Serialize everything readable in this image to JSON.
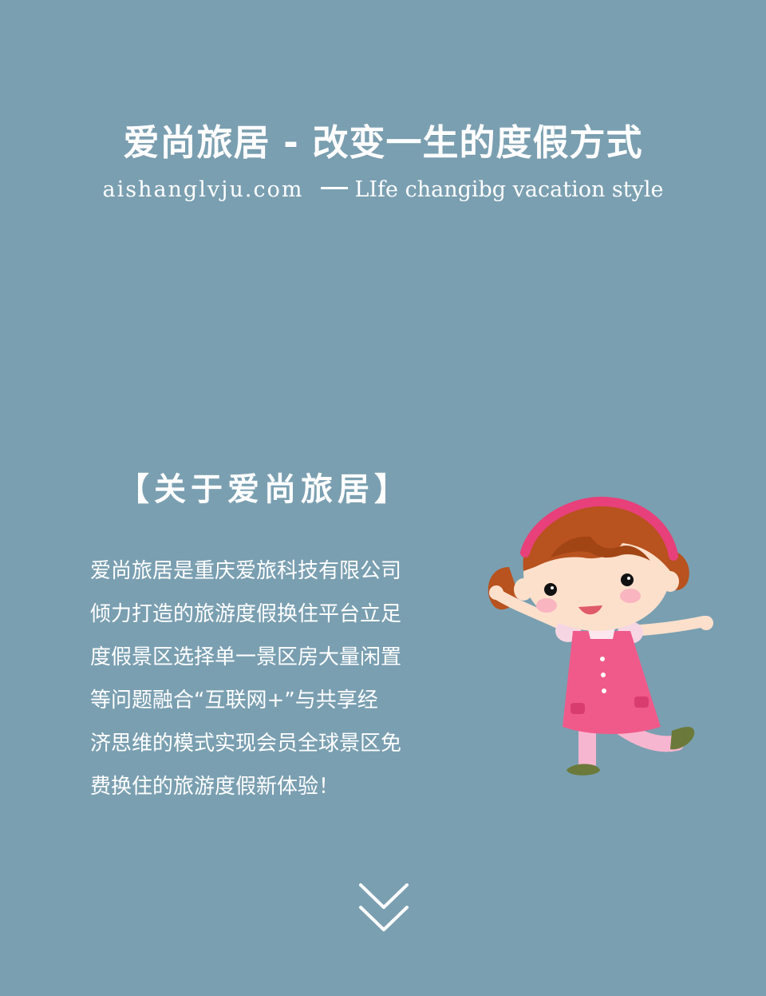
{
  "hero": {
    "title": "爱尚旅居 - 改变一生的度假方式",
    "domain": "aishanglvju.com",
    "tagline": "LIfe changibg vacation style"
  },
  "about": {
    "title": "【关于爱尚旅居】",
    "lines": [
      "爱尚旅居是重庆爱旅科技有限公司",
      "倾力打造的旅游度假换住平台立足",
      "度假景区选择单一景区房大量闲置",
      "等问题融合“互联网+”与共享经",
      "济思维的模式实现会员全球景区免",
      "费换住的旅游度假新体验！"
    ]
  },
  "icons": {
    "scroll": "double-chevron-down-icon",
    "illustration": "cartoon-girl-illustration"
  },
  "colors": {
    "background": "#7a9fb1",
    "text": "#ffffff",
    "dress": "#f05a8a",
    "headband": "#e8407a",
    "hair": "#b8521e"
  }
}
